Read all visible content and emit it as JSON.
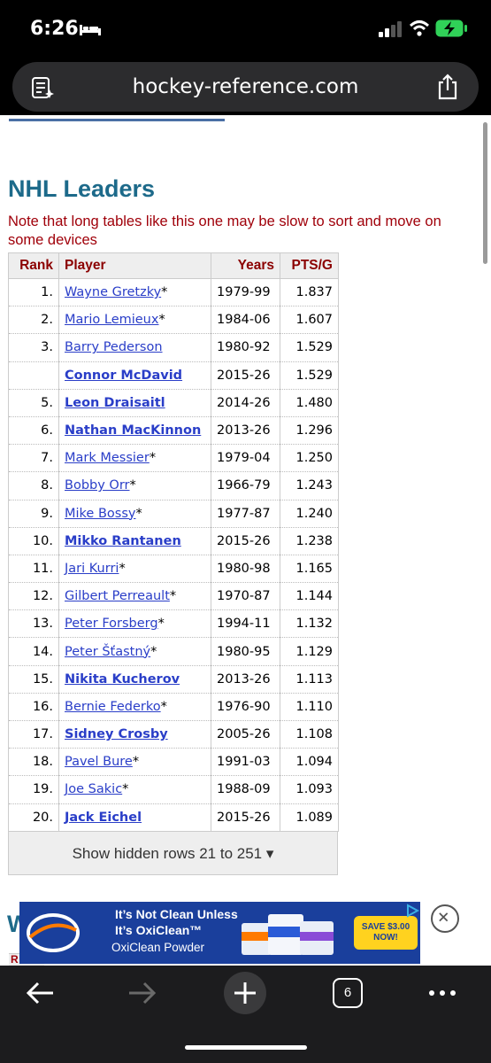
{
  "status": {
    "time": "6:26"
  },
  "browser": {
    "url": "hockey-reference.com",
    "tab_count": "6"
  },
  "page": {
    "heading": "NHL Leaders",
    "note": "Note that long tables like this one may be slow to sort and move on some devices",
    "peek_heading": "W",
    "peek_table_header": "R"
  },
  "table": {
    "headers": [
      "Rank",
      "Player",
      "Years",
      "PTS/G"
    ],
    "rows": [
      {
        "rank": "1.",
        "player": "Wayne Gretzky",
        "hof": "*",
        "active": false,
        "years": "1979-99",
        "ptsg": "1.837"
      },
      {
        "rank": "2.",
        "player": "Mario Lemieux",
        "hof": "*",
        "active": false,
        "years": "1984-06",
        "ptsg": "1.607"
      },
      {
        "rank": "3.",
        "player": "Barry Pederson",
        "hof": "",
        "active": false,
        "years": "1980-92",
        "ptsg": "1.529"
      },
      {
        "rank": "",
        "player": "Connor McDavid",
        "hof": "",
        "active": true,
        "years": "2015-26",
        "ptsg": "1.529"
      },
      {
        "rank": "5.",
        "player": "Leon Draisaitl",
        "hof": "",
        "active": true,
        "years": "2014-26",
        "ptsg": "1.480"
      },
      {
        "rank": "6.",
        "player": "Nathan MacKinnon",
        "hof": "",
        "active": true,
        "years": "2013-26",
        "ptsg": "1.296"
      },
      {
        "rank": "7.",
        "player": "Mark Messier",
        "hof": "*",
        "active": false,
        "years": "1979-04",
        "ptsg": "1.250"
      },
      {
        "rank": "8.",
        "player": "Bobby Orr",
        "hof": "*",
        "active": false,
        "years": "1966-79",
        "ptsg": "1.243"
      },
      {
        "rank": "9.",
        "player": "Mike Bossy",
        "hof": "*",
        "active": false,
        "years": "1977-87",
        "ptsg": "1.240"
      },
      {
        "rank": "10.",
        "player": "Mikko Rantanen",
        "hof": "",
        "active": true,
        "years": "2015-26",
        "ptsg": "1.238"
      },
      {
        "rank": "11.",
        "player": "Jari Kurri",
        "hof": "*",
        "active": false,
        "years": "1980-98",
        "ptsg": "1.165"
      },
      {
        "rank": "12.",
        "player": "Gilbert Perreault",
        "hof": "*",
        "active": false,
        "years": "1970-87",
        "ptsg": "1.144"
      },
      {
        "rank": "13.",
        "player": "Peter Forsberg",
        "hof": "*",
        "active": false,
        "years": "1994-11",
        "ptsg": "1.132"
      },
      {
        "rank": "14.",
        "player": "Peter Šťastný",
        "hof": "*",
        "active": false,
        "years": "1980-95",
        "ptsg": "1.129"
      },
      {
        "rank": "15.",
        "player": "Nikita Kucherov",
        "hof": "",
        "active": true,
        "years": "2013-26",
        "ptsg": "1.113"
      },
      {
        "rank": "16.",
        "player": "Bernie Federko",
        "hof": "*",
        "active": false,
        "years": "1976-90",
        "ptsg": "1.110"
      },
      {
        "rank": "17.",
        "player": "Sidney Crosby",
        "hof": "",
        "active": true,
        "years": "2005-26",
        "ptsg": "1.108"
      },
      {
        "rank": "18.",
        "player": "Pavel Bure",
        "hof": "*",
        "active": false,
        "years": "1991-03",
        "ptsg": "1.094"
      },
      {
        "rank": "19.",
        "player": "Joe Sakic",
        "hof": "*",
        "active": false,
        "years": "1988-09",
        "ptsg": "1.093"
      },
      {
        "rank": "20.",
        "player": "Jack Eichel",
        "hof": "",
        "active": true,
        "years": "2015-26",
        "ptsg": "1.089"
      }
    ],
    "show_hidden": "Show hidden rows 21 to 251 ▾"
  },
  "ad": {
    "logo_text": "OXI CLEAN",
    "line1": "It’s Not Clean Unless",
    "line2": "It’s OxiClean™",
    "line3": "OxiClean Powder",
    "badge": "SAVE $3.00 NOW!"
  },
  "colors": {
    "heading": "#1d6a8a",
    "note": "#a0000a",
    "link": "#2a3ec8",
    "ad_bg": "#1a3f9c",
    "badge": "#ffd21f"
  },
  "icons": [
    "bed-icon",
    "signal-icon",
    "wifi-icon",
    "battery-charging-icon",
    "reader-mode-icon",
    "share-icon",
    "back-arrow-icon",
    "forward-arrow-icon",
    "new-tab-plus-icon",
    "tabs-icon",
    "more-icon",
    "ad-close-icon"
  ]
}
